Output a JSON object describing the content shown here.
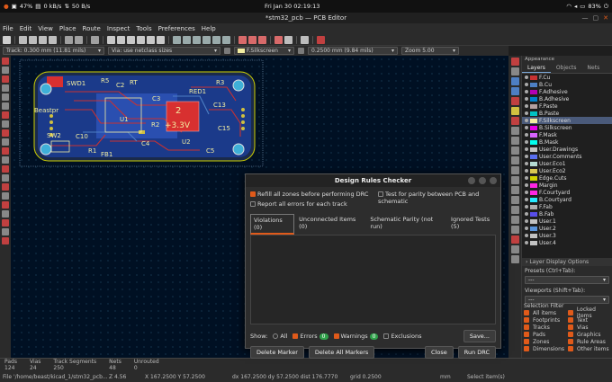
{
  "system_bar": {
    "cpu": "47%",
    "mem": "0 kB/s",
    "net": "50 B/s",
    "clock": "Fri Jan 30  02:19:13",
    "battery": "83%"
  },
  "window": {
    "title": "*stm32_pcb — PCB Editor"
  },
  "menu": [
    "File",
    "Edit",
    "View",
    "Place",
    "Route",
    "Inspect",
    "Tools",
    "Preferences",
    "Help"
  ],
  "options": {
    "track": "Track: 0.300 mm (11.81 mils)",
    "via": "Via: use netclass sizes",
    "layer": "F.Silkscreen",
    "grid": "0.2500 mm (9.84 mils)",
    "zoom": "Zoom 5.00"
  },
  "pcb": {
    "power_value": "2",
    "power_label": "+3.3V",
    "labels": [
      "SWD1",
      "R5",
      "C2",
      "RT",
      "C3",
      "R3",
      "C13",
      "C15",
      "Beastpr",
      "U1",
      "SW2",
      "C10",
      "R1",
      "FB1",
      "C4",
      "R2",
      "U2",
      "C5",
      "RED1"
    ]
  },
  "panel": {
    "header": "Appearance",
    "tabs": [
      "Layers",
      "Objects",
      "Nets"
    ],
    "layers": [
      {
        "name": "F.Cu",
        "color": "#c83232"
      },
      {
        "name": "B.Cu",
        "color": "#4d7fc4"
      },
      {
        "name": "F.Adhesive",
        "color": "#b400b4"
      },
      {
        "name": "B.Adhesive",
        "color": "#0080cc"
      },
      {
        "name": "F.Paste",
        "color": "#b4a0a0"
      },
      {
        "name": "B.Paste",
        "color": "#00c2c2"
      },
      {
        "name": "F.Silkscreen",
        "color": "#f2eda1"
      },
      {
        "name": "B.Silkscreen",
        "color": "#e800e8"
      },
      {
        "name": "F.Mask",
        "color": "#d864ff"
      },
      {
        "name": "B.Mask",
        "color": "#02ffee"
      },
      {
        "name": "User.Drawings",
        "color": "#c2c2c2"
      },
      {
        "name": "User.Comments",
        "color": "#596ef0"
      },
      {
        "name": "User.Eco1",
        "color": "#b4dbd2"
      },
      {
        "name": "User.Eco2",
        "color": "#d8c852"
      },
      {
        "name": "Edge.Cuts",
        "color": "#d0d200"
      },
      {
        "name": "Margin",
        "color": "#ff26e2"
      },
      {
        "name": "F.Courtyard",
        "color": "#ff26e2"
      },
      {
        "name": "B.Courtyard",
        "color": "#26e9ff"
      },
      {
        "name": "F.Fab",
        "color": "#afafaf"
      },
      {
        "name": "B.Fab",
        "color": "#584dea"
      },
      {
        "name": "User.1",
        "color": "#c2c2c2"
      },
      {
        "name": "User.2",
        "color": "#5994dc"
      },
      {
        "name": "User.3",
        "color": "#c2c2c2"
      },
      {
        "name": "User.4",
        "color": "#c2c2c2"
      }
    ],
    "selected_layer": "F.Silkscreen",
    "layer_display_options": "Layer Display Options",
    "presets_label": "Presets (Ctrl+Tab):",
    "presets_value": "---",
    "viewports_label": "Viewports (Shift+Tab):",
    "viewports_value": "---",
    "selection_filter": "Selection Filter",
    "filter_items": [
      "All items",
      "Locked items",
      "Footprints",
      "Text",
      "Tracks",
      "Vias",
      "Pads",
      "Graphics",
      "Zones",
      "Rule Areas",
      "Dimensions",
      "Other items"
    ]
  },
  "status": {
    "labels": [
      "Pads",
      "Vias",
      "Track Segments",
      "Nets",
      "Unrouted"
    ],
    "values": [
      "124",
      "24",
      "250",
      "48",
      "0"
    ],
    "file": "File '/home/beast/kicad_1/stm32_pcb...",
    "z": "Z 4.56",
    "xy": "X 167.2500  Y 57.2500",
    "dxy": "dx 167.2500  dy 57.2500  dist 176.7770",
    "grid": "grid 0.2500",
    "units": "mm",
    "mode": "Select item(s)"
  },
  "drc": {
    "title": "Design Rules Checker",
    "opt_refill": "Refill all zones before performing DRC",
    "opt_parity": "Test for parity between PCB and schematic",
    "opt_report_all": "Report all errors for each track",
    "tabs": [
      "Violations (0)",
      "Unconnected Items (0)",
      "Schematic Parity (not run)",
      "Ignored Tests (5)"
    ],
    "show": "Show:",
    "all": "All",
    "errors": "Errors",
    "errors_count": "0",
    "warnings": "Warnings",
    "warnings_count": "0",
    "exclusions": "Exclusions",
    "save": "Save...",
    "delete_marker": "Delete Marker",
    "delete_all": "Delete All Markers",
    "close": "Close",
    "run": "Run DRC"
  }
}
